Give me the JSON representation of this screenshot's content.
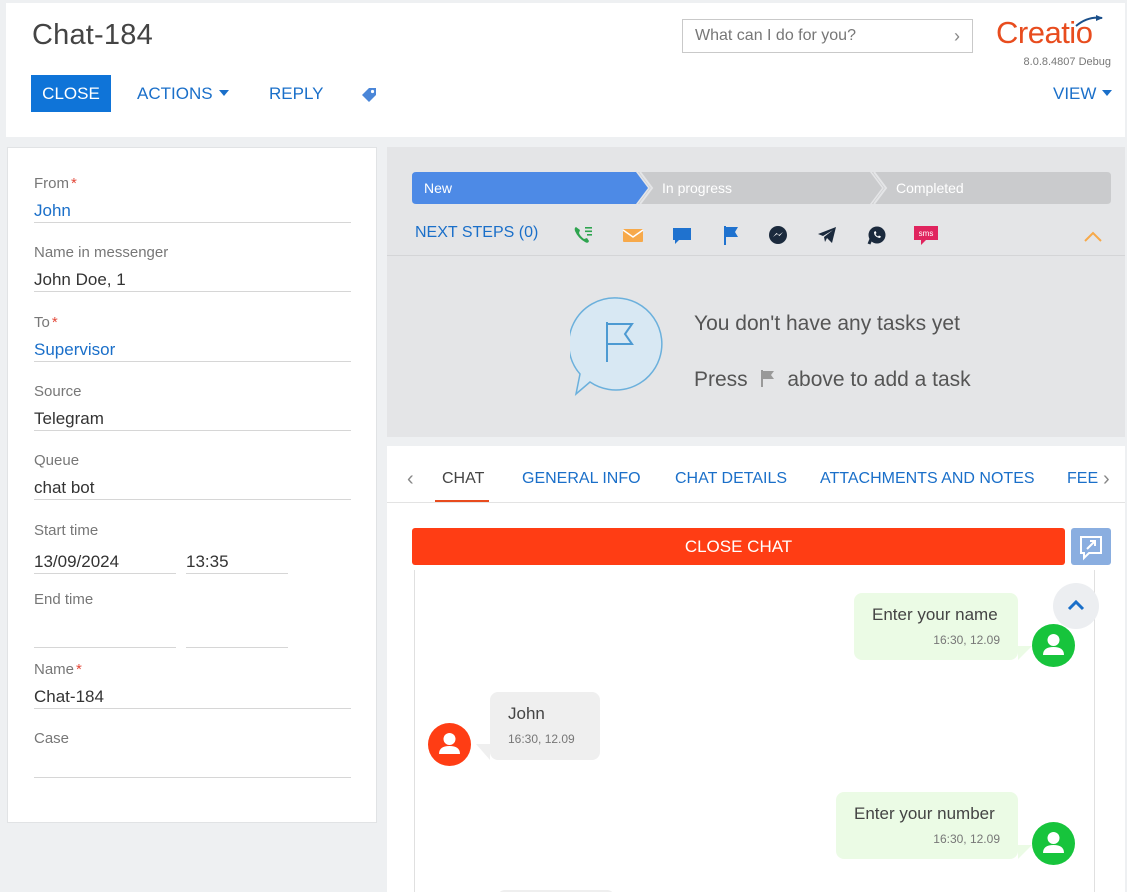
{
  "header": {
    "title": "Chat-184",
    "search_placeholder": "What can I do for you?",
    "logo": "Creatio",
    "version": "8.0.8.4807 Debug",
    "close_label": "CLOSE",
    "actions_label": "ACTIONS",
    "reply_label": "REPLY",
    "view_label": "VIEW"
  },
  "fields": {
    "from_label": "From",
    "from_value": "John",
    "messenger_name_label": "Name in messenger",
    "messenger_name_value": "John Doe, 1",
    "to_label": "To",
    "to_value": "Supervisor",
    "source_label": "Source",
    "source_value": "Telegram",
    "queue_label": "Queue",
    "queue_value": "chat bot",
    "start_time_label": "Start time",
    "start_date": "13/09/2024",
    "start_time": "13:35",
    "end_time_label": "End time",
    "name_label": "Name",
    "name_value": "Chat-184",
    "case_label": "Case"
  },
  "stages": [
    "New",
    "In progress",
    "Completed"
  ],
  "next_steps": {
    "label": "NEXT STEPS (0)",
    "actions": [
      "call-icon",
      "email-icon",
      "chat-icon",
      "task-flag-icon",
      "messenger-icon",
      "telegram-icon",
      "whatsapp-icon",
      "sms-icon"
    ],
    "empty_line1": "You don't have any tasks yet",
    "empty_press": "Press",
    "empty_suffix": "above to add a task"
  },
  "tabs": [
    "CHAT",
    "GENERAL INFO",
    "CHAT DETAILS",
    "ATTACHMENTS AND NOTES",
    "FEED"
  ],
  "chat": {
    "close_chat_label": "CLOSE CHAT",
    "messages": [
      {
        "direction": "out",
        "text": "Enter your name",
        "time": "16:30, 12.09"
      },
      {
        "direction": "in",
        "text": "John",
        "time": "16:30, 12.09"
      },
      {
        "direction": "out",
        "text": "Enter your number",
        "time": "16:30, 12.09"
      }
    ]
  },
  "colors": {
    "accent": "#0f74d8",
    "brand": "#e84c1e",
    "close_chat": "#ff3d14",
    "stage_active": "#4d8ae6",
    "stage_inactive": "#cacbcd"
  }
}
